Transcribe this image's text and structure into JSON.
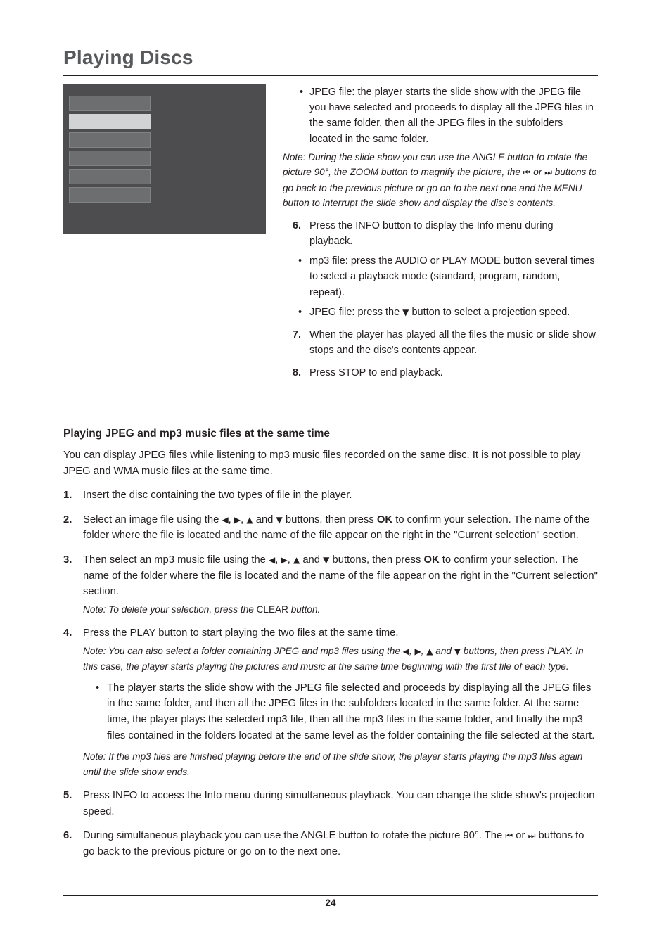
{
  "page": {
    "title": "Playing Discs",
    "number": "24"
  },
  "top_right": {
    "bullet1": "JPEG file: the player starts the slide show with the JPEG file you have selected and proceeds to display all the JPEG files in the same folder, then all the JPEG files in the subfolders located in the same folder.",
    "note1_part1": "Note: During the slide show you can use the ANGLE button to rotate the picture 90°, the ZOOM button to magnify the picture, the",
    "note1_icon1": "⏮",
    "note1_mid": "or",
    "note1_icon2": "⏭",
    "note1_part2": "buttons to go back to the previous picture or go on to the next one and the MENU button to interrupt the slide show and display the disc's contents.",
    "step6_num": "6.",
    "step6_text": "Press the INFO button to display the Info menu during playback.",
    "step6_b1": "mp3 file: press the AUDIO or PLAY MODE button several times to select a playback mode (standard, program, random, repeat).",
    "step6_b2_pre": "JPEG file: press the",
    "step6_b2_icon": "▼",
    "step6_b2_post": "button to select a projection speed.",
    "step7_num": "7.",
    "step7_text": "When the player has played all the files the music or slide show stops and the disc's contents appear.",
    "step8_num": "8.",
    "step8_text": "Press STOP to end playback."
  },
  "section": {
    "heading": "Playing JPEG and mp3 music files at the same time",
    "intro": "You can display JPEG files while listening to mp3 music files recorded on the same disc. It is not possible to play JPEG and WMA music files at the same time.",
    "steps": [
      {
        "num": "1.",
        "text": "Insert the disc containing the two types of file in the player."
      },
      {
        "num": "2.",
        "pre": "Select an image file using the",
        "post_arrows": "buttons, then press",
        "ok": "OK",
        "post": "to confirm your selection. The name of the folder where the file is located and the name of the file appear on the right in the \"Current selection\" section."
      },
      {
        "num": "3.",
        "pre": "Then select an mp3 music file using the",
        "post_arrows": "buttons, then press",
        "ok": "OK",
        "post": "to confirm your selection. The name of the folder where the file is located and the name of the file appear on the right in the \"Current selection\" section.",
        "note_pre": "Note: To delete your selection, press the",
        "note_bold": "CLEAR",
        "note_post": "button."
      },
      {
        "num": "4.",
        "text": "Press the PLAY button to start playing the two files at the same time.",
        "note_pre": "Note: You can also select a folder containing JPEG and mp3 files using the",
        "note_mid": "and",
        "note_post": "buttons, then press PLAY. In this case, the player starts playing the pictures and music at the same time beginning with the first file of each type.",
        "bullet": "The player starts the slide show with the JPEG file selected and proceeds by displaying all the JPEG files in the same folder, and then all the JPEG files in the subfolders located in the same folder. At the same time, the player plays the selected mp3 file, then all the mp3 files in the same folder, and finally the mp3 files contained in the folders located at the same level as the folder containing the file selected at the start.",
        "note2": "Note: If the mp3 files are finished playing before the end of the slide show, the player starts playing the mp3 files again until the slide show ends."
      },
      {
        "num": "5.",
        "text": "Press INFO to access the Info menu during simultaneous playback. You can change the slide show's projection speed."
      },
      {
        "num": "6.",
        "pre": "During simultaneous playback you can use the ANGLE button to rotate the picture 90°. The",
        "icon1": "⏮",
        "mid": "or",
        "icon2": "⏭",
        "post": "buttons to go back to the previous picture or go on to the next one."
      }
    ]
  },
  "icons": {
    "left": "◀",
    "right": "▶",
    "up": "▲",
    "down": "▼",
    "prev": "⏮",
    "next": "⏭"
  },
  "screenshot": {
    "rows": [
      "row-top",
      "row-highlight",
      "row-3",
      "row-4",
      "row-5",
      "row-6"
    ]
  },
  "colors": {
    "title": "#58595b",
    "text": "#231f20",
    "screen_bg": "#4d4d4f",
    "row_bg": "#6d6e70",
    "row_highlight": "#d1d3d4"
  }
}
